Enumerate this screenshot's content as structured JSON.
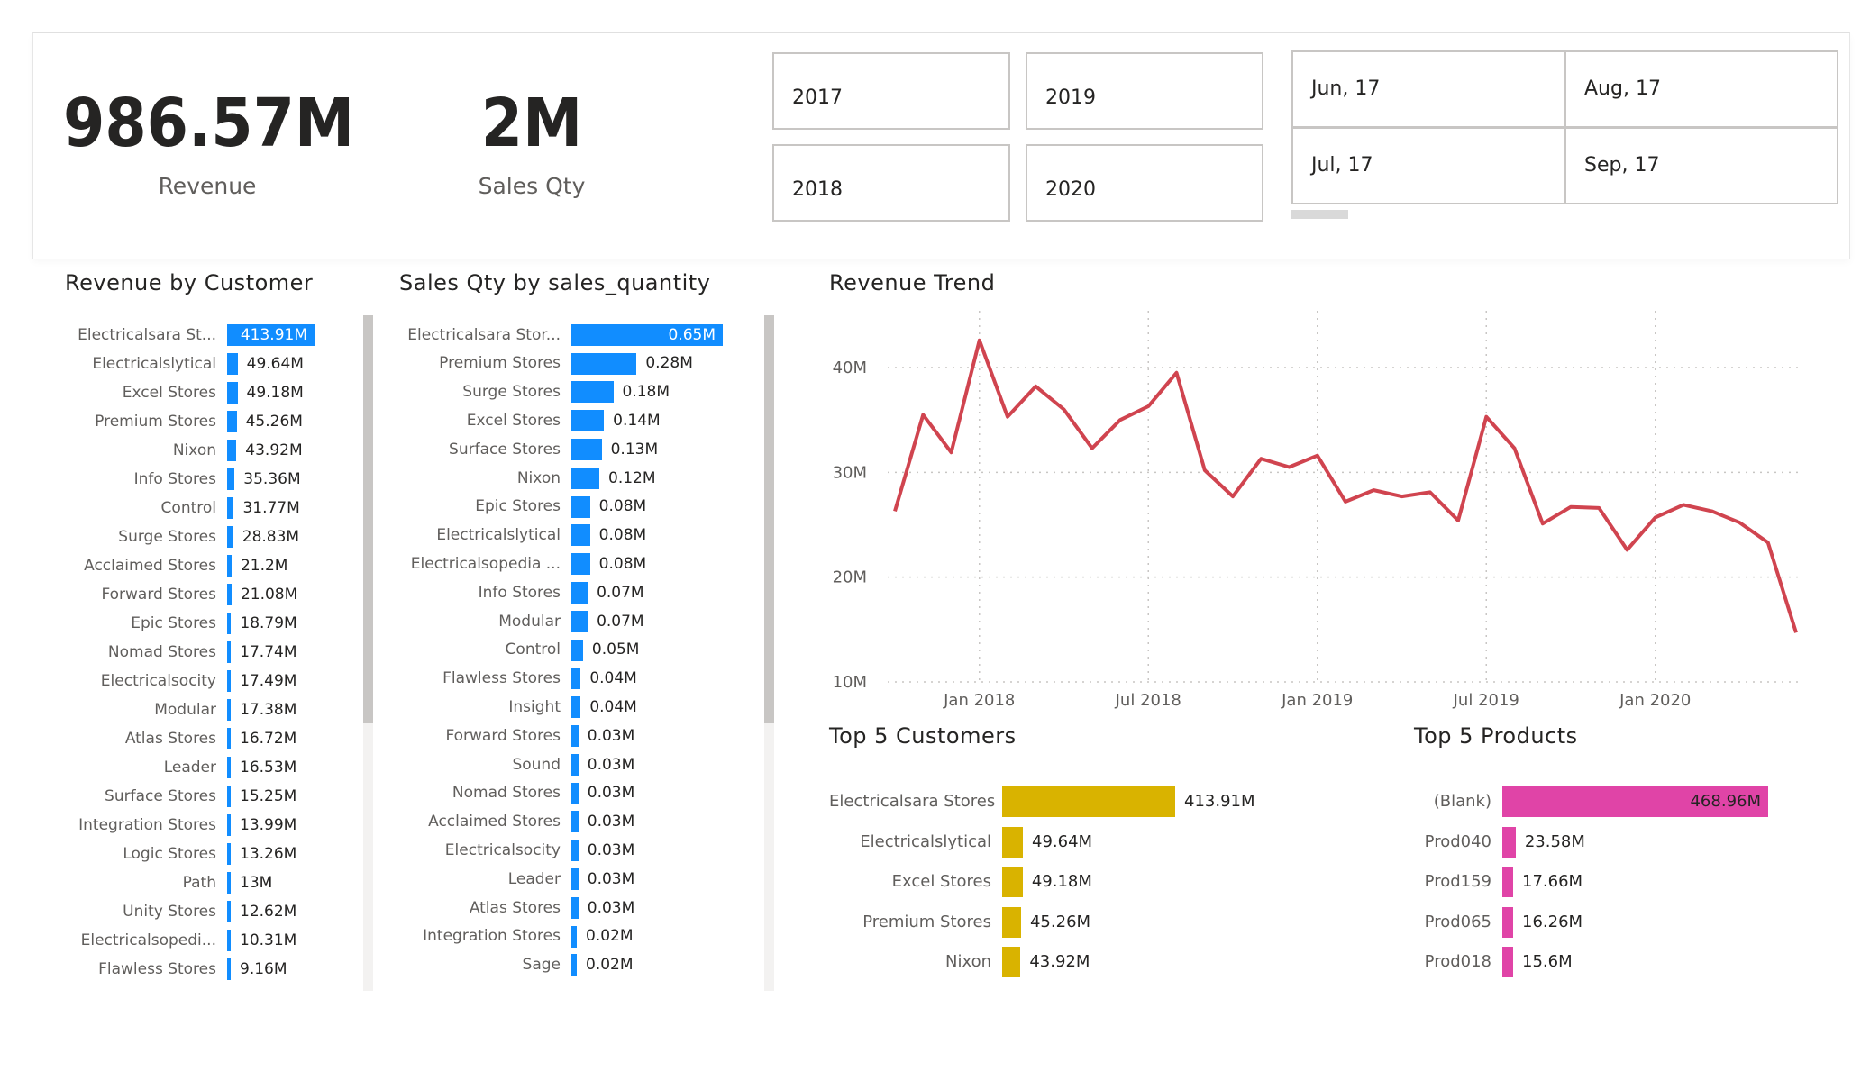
{
  "kpis": {
    "revenue": {
      "value": "986.57M",
      "label": "Revenue"
    },
    "sales_qty": {
      "value": "2M",
      "label": "Sales Qty"
    }
  },
  "year_slicer": [
    "2017",
    "2019",
    "2018",
    "2020"
  ],
  "month_slicer": [
    "Jun, 17",
    "Aug, 17",
    "Jul, 17",
    "Sep, 17"
  ],
  "colors": {
    "accent_blue": "#118dff",
    "line_red": "#d0444f",
    "gold": "#d9b300",
    "pink": "#e044a7"
  },
  "chart_data": [
    {
      "type": "bar",
      "title": "Revenue by Customer",
      "orientation": "horizontal",
      "categories": [
        "Electricalsara St...",
        "Electricalslytical",
        "Excel Stores",
        "Premium Stores",
        "Nixon",
        "Info Stores",
        "Control",
        "Surge Stores",
        "Acclaimed Stores",
        "Forward Stores",
        "Epic Stores",
        "Nomad Stores",
        "Electricalsocity",
        "Modular",
        "Atlas Stores",
        "Leader",
        "Surface Stores",
        "Integration Stores",
        "Logic Stores",
        "Path",
        "Unity Stores",
        "Electricalsopedi...",
        "Flawless Stores"
      ],
      "values": [
        413.91,
        49.64,
        49.18,
        45.26,
        43.92,
        35.36,
        31.77,
        28.83,
        21.2,
        21.08,
        18.79,
        17.74,
        17.49,
        17.38,
        16.72,
        16.53,
        15.25,
        13.99,
        13.26,
        13,
        12.62,
        10.31,
        9.16
      ],
      "labels": [
        "413.91M",
        "49.64M",
        "49.18M",
        "45.26M",
        "43.92M",
        "35.36M",
        "31.77M",
        "28.83M",
        "21.2M",
        "21.08M",
        "18.79M",
        "17.74M",
        "17.49M",
        "17.38M",
        "16.72M",
        "16.53M",
        "15.25M",
        "13.99M",
        "13.26M",
        "13M",
        "12.62M",
        "10.31M",
        "9.16M"
      ],
      "max": 413.91,
      "color": "#118dff"
    },
    {
      "type": "bar",
      "title": "Sales Qty by sales_quantity",
      "orientation": "horizontal",
      "categories": [
        "Electricalsara Stor...",
        "Premium Stores",
        "Surge Stores",
        "Excel Stores",
        "Surface Stores",
        "Nixon",
        "Epic Stores",
        "Electricalslytical",
        "Electricalsopedia ...",
        "Info Stores",
        "Modular",
        "Control",
        "Flawless Stores",
        "Insight",
        "Forward Stores",
        "Sound",
        "Nomad Stores",
        "Acclaimed Stores",
        "Electricalsocity",
        "Leader",
        "Atlas Stores",
        "Integration Stores",
        "Sage"
      ],
      "values": [
        0.65,
        0.28,
        0.18,
        0.14,
        0.13,
        0.12,
        0.08,
        0.08,
        0.08,
        0.07,
        0.07,
        0.05,
        0.04,
        0.04,
        0.03,
        0.03,
        0.03,
        0.03,
        0.03,
        0.03,
        0.03,
        0.02,
        0.02
      ],
      "labels": [
        "0.65M",
        "0.28M",
        "0.18M",
        "0.14M",
        "0.13M",
        "0.12M",
        "0.08M",
        "0.08M",
        "0.08M",
        "0.07M",
        "0.07M",
        "0.05M",
        "0.04M",
        "0.04M",
        "0.03M",
        "0.03M",
        "0.03M",
        "0.03M",
        "0.03M",
        "0.03M",
        "0.03M",
        "0.02M",
        "0.02M"
      ],
      "max": 0.65,
      "color": "#118dff"
    },
    {
      "type": "line",
      "title": "Revenue Trend",
      "x": [
        "2017-10",
        "2017-11",
        "2017-12",
        "2018-01",
        "2018-02",
        "2018-03",
        "2018-04",
        "2018-05",
        "2018-06",
        "2018-07",
        "2018-08",
        "2018-09",
        "2018-10",
        "2018-11",
        "2018-12",
        "2019-01",
        "2019-02",
        "2019-03",
        "2019-04",
        "2019-05",
        "2019-06",
        "2019-07",
        "2019-08",
        "2019-09",
        "2019-10",
        "2019-11",
        "2019-12",
        "2020-01",
        "2020-02",
        "2020-03",
        "2020-04",
        "2020-05",
        "2020-06"
      ],
      "y": [
        26.3,
        35.5,
        31.9,
        42.6,
        35.3,
        38.2,
        36.0,
        32.3,
        35.0,
        36.3,
        39.5,
        30.2,
        27.7,
        31.3,
        30.5,
        31.6,
        27.2,
        28.3,
        27.7,
        28.1,
        25.4,
        35.3,
        32.3,
        25.1,
        26.7,
        26.6,
        22.6,
        25.7,
        26.9,
        26.3,
        25.2,
        23.3,
        14.7
      ],
      "y_ticks": [
        "10M",
        "20M",
        "30M",
        "40M"
      ],
      "x_ticks": [
        "Jan 2018",
        "Jul 2018",
        "Jan 2019",
        "Jul 2019",
        "Jan 2020"
      ],
      "ylim": [
        10,
        45
      ],
      "grid": true,
      "color": "#d0444f"
    },
    {
      "type": "bar",
      "title": "Top 5 Customers",
      "orientation": "horizontal",
      "categories": [
        "Electricalsara Stores",
        "Electricalslytical",
        "Excel Stores",
        "Premium Stores",
        "Nixon"
      ],
      "values": [
        413.91,
        49.64,
        49.18,
        45.26,
        43.92
      ],
      "labels": [
        "413.91M",
        "49.64M",
        "49.18M",
        "45.26M",
        "43.92M"
      ],
      "max": 413.91,
      "color": "#d9b300"
    },
    {
      "type": "bar",
      "title": "Top 5 Products",
      "orientation": "horizontal",
      "categories": [
        "(Blank)",
        "Prod040",
        "Prod159",
        "Prod065",
        "Prod018"
      ],
      "values": [
        468.96,
        23.58,
        17.66,
        16.26,
        15.6
      ],
      "labels": [
        "468.96M",
        "23.58M",
        "17.66M",
        "16.26M",
        "15.6M"
      ],
      "max": 468.96,
      "color": "#e044a7"
    }
  ]
}
